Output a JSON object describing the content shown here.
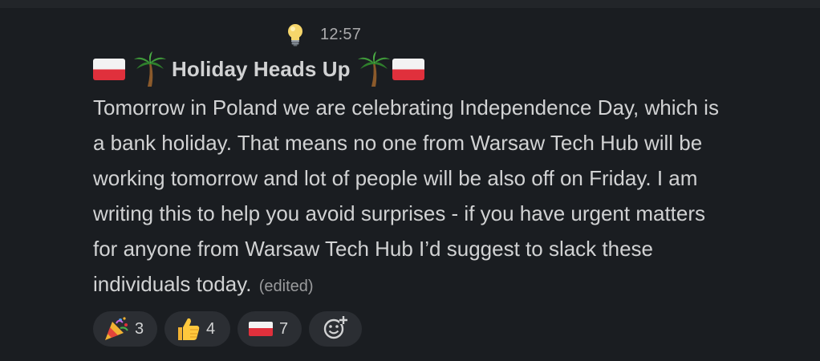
{
  "message": {
    "timestamp": "12:57",
    "title": "Holiday Heads Up",
    "title_decorations": {
      "left": [
        "poland-flag-icon",
        "palm-tree-icon"
      ],
      "right": [
        "palm-tree-icon",
        "poland-flag-icon"
      ]
    },
    "lines": [
      "Tomorrow in Poland we are celebrating Independence Day, which is",
      "a bank holiday. That means no one from Warsaw Tech Hub will be",
      "working tomorrow and lot of people will be also off on Friday. I am",
      "writing this to help you avoid surprises - if you have urgent matters",
      "for anyone from Warsaw Tech Hub I’d suggest to slack these",
      "individuals today."
    ],
    "edited_label": "(edited)"
  },
  "reactions": [
    {
      "icon": "party-popper-icon",
      "count": "3"
    },
    {
      "icon": "thumbs-up-icon",
      "count": "4"
    },
    {
      "icon": "poland-flag-icon",
      "count": "7"
    }
  ],
  "add_reaction_icon": "add-reaction-icon",
  "colors": {
    "background": "#1a1d21",
    "text": "#d1d2d3",
    "muted": "#ababad",
    "reaction_bg": "#2b2e33"
  }
}
